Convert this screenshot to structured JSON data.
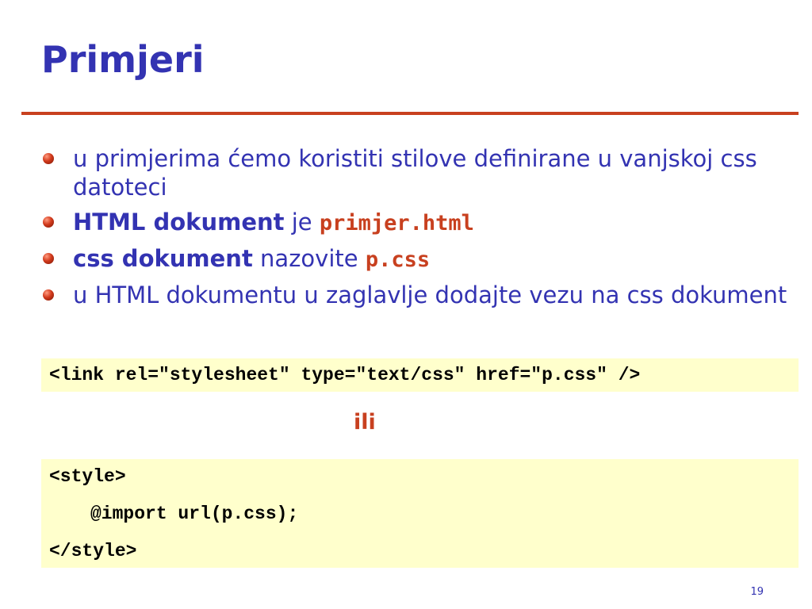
{
  "slide": {
    "title": "Primjeri",
    "bullets": [
      {
        "text": "u primjerima ćemo koristiti stilove definirane u vanjskoj css datoteci"
      },
      {
        "bold": "HTML dokument",
        "text": " je ",
        "code": "primjer.html"
      },
      {
        "bold": "css dokument",
        "text": " nazovite ",
        "code": "p.css"
      },
      {
        "text": "u HTML dokumentu u zaglavlje dodajte vezu na css dokument"
      }
    ],
    "link_code": "<link rel=\"stylesheet\" type=\"text/css\" href=\"p.css\" />",
    "separator": "ili",
    "style_code": [
      "<style>",
      "@import url(p.css);",
      "</style>"
    ],
    "page_number": "19"
  },
  "colors": {
    "title": "#3333b2",
    "accent": "#c8401f",
    "code_background": "#ffffcc"
  },
  "icons": {
    "bullet": "red-sphere-bullet-icon"
  }
}
